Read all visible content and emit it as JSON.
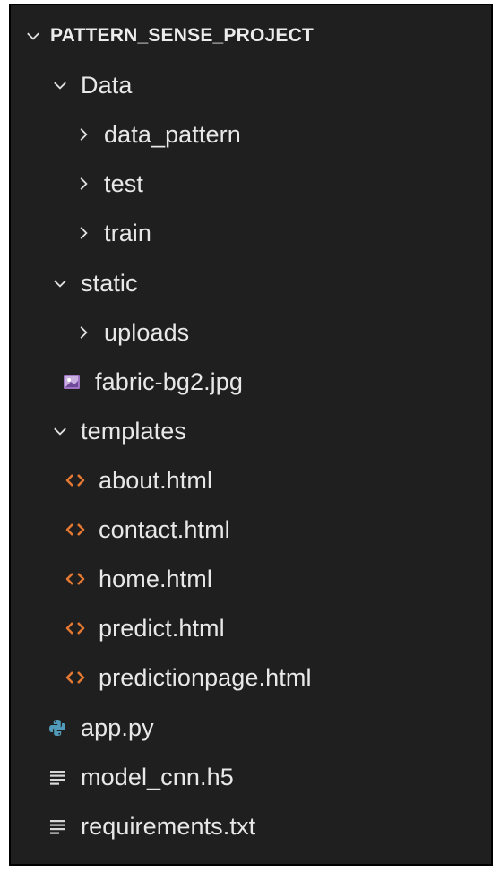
{
  "explorer": {
    "project_name": "PATTERN_SENSE_PROJECT",
    "colors": {
      "background": "#1f1f1f",
      "text": "#e8e8e8",
      "html_icon": "#e37933",
      "python_icon": "#519aba",
      "image_icon": "#a074c4"
    },
    "tree": {
      "data_folder": "Data",
      "data_pattern_folder": "data_pattern",
      "test_folder": "test",
      "train_folder": "train",
      "static_folder": "static",
      "uploads_folder": "uploads",
      "fabric_image": "fabric-bg2.jpg",
      "templates_folder": "templates",
      "about_file": "about.html",
      "contact_file": "contact.html",
      "home_file": "home.html",
      "predict_file": "predict.html",
      "predictionpage_file": "predictionpage.html",
      "app_file": "app.py",
      "model_file": "model_cnn.h5",
      "requirements_file": "requirements.txt"
    },
    "icons": {
      "expanded": "chevron-down-icon",
      "collapsed": "chevron-right-icon",
      "html": "html-file-icon",
      "python": "python-file-icon",
      "image": "image-file-icon",
      "text": "text-file-icon"
    }
  }
}
